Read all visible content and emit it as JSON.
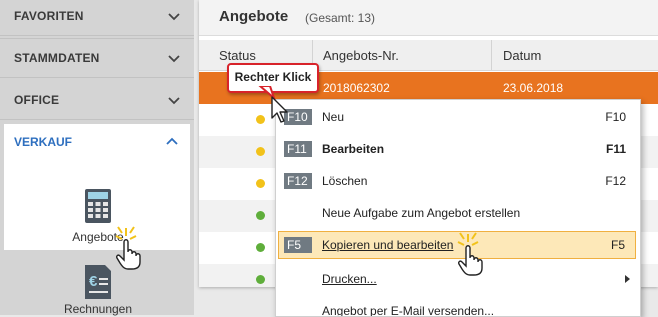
{
  "sidebar": {
    "sections": [
      {
        "label": "FAVORITEN"
      },
      {
        "label": "STAMMDATEN"
      },
      {
        "label": "OFFICE"
      },
      {
        "label": "VERKAUF"
      }
    ],
    "tiles": [
      {
        "label": "Angebote"
      },
      {
        "label": "Rechnungen"
      }
    ]
  },
  "window": {
    "title": "Angebote",
    "total": "(Gesamt: 13)"
  },
  "grid": {
    "columns": [
      "Status",
      "Angebots-Nr.",
      "Datum"
    ],
    "selected_row": {
      "number": "2018062302",
      "date": "23.06.2018"
    },
    "status_dots": [
      "yellow",
      "yellow",
      "yellow",
      "green",
      "green",
      "green",
      "green"
    ]
  },
  "callout": {
    "label": "Rechter Klick"
  },
  "context_menu": {
    "items": [
      {
        "key": "F10",
        "label": "Neu",
        "shortcut": "F10"
      },
      {
        "key": "F11",
        "label": "Bearbeiten",
        "shortcut": "F11"
      },
      {
        "key": "F12",
        "label": "Löschen",
        "shortcut": "F12"
      },
      {
        "key": "",
        "label": "Neue Aufgabe zum Angebot erstellen",
        "shortcut": ""
      },
      {
        "key": "F5",
        "label": "Kopieren und bearbeiten",
        "shortcut": "F5"
      },
      {
        "key": "",
        "label": "Drucken...",
        "shortcut": ""
      },
      {
        "key": "",
        "label": "Angebot per E-Mail versenden...",
        "shortcut": ""
      }
    ]
  },
  "colors": {
    "accent_orange": "#e8731f",
    "link_blue": "#2e6fbf",
    "highlight": "#fde8b8",
    "status_yellow": "#f2c21a",
    "status_green": "#5fae3b",
    "callout_red": "#d8232a"
  },
  "icons": [
    "chevron-down-icon",
    "chevron-up-icon",
    "calculator-icon",
    "invoice-euro-icon",
    "hand-cursor-icon",
    "arrow-cursor-icon",
    "submenu-arrow-icon"
  ]
}
